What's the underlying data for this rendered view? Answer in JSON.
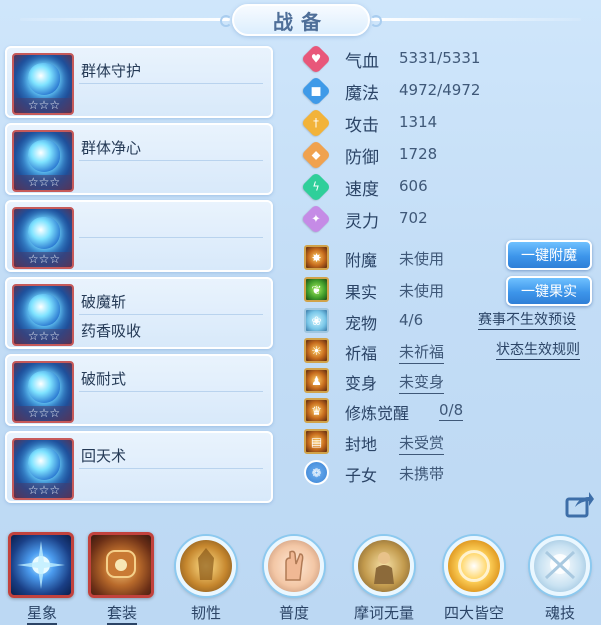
{
  "title": "战备",
  "skills": [
    {
      "name1": "群体守护",
      "name2": "",
      "stars": "☆☆☆"
    },
    {
      "name1": "群体净心",
      "name2": "",
      "stars": "☆☆☆"
    },
    {
      "name1": "",
      "name2": "",
      "stars": "☆☆☆"
    },
    {
      "name1": "破魔斩",
      "name2": "药香吸收",
      "stars": "☆☆☆"
    },
    {
      "name1": "破耐式",
      "name2": "",
      "stars": "☆☆☆"
    },
    {
      "name1": "回天术",
      "name2": "",
      "stars": "☆☆☆"
    }
  ],
  "stats": [
    {
      "label": "气血",
      "value": "5331/5331",
      "color": "#e8577a",
      "icon": "heart-icon",
      "glyph": "♥"
    },
    {
      "label": "魔法",
      "value": "4972/4972",
      "color": "#3f9ae8",
      "icon": "mana-icon",
      "glyph": "■"
    },
    {
      "label": "攻击",
      "value": "1314",
      "color": "#f2b33a",
      "icon": "sword-icon",
      "glyph": "†"
    },
    {
      "label": "防御",
      "value": "1728",
      "color": "#f0a24f",
      "icon": "shield-icon",
      "glyph": "◆"
    },
    {
      "label": "速度",
      "value": "606",
      "color": "#2fcf9a",
      "icon": "lightning-icon",
      "glyph": "ϟ"
    },
    {
      "label": "灵力",
      "value": "702",
      "color": "#c58be6",
      "icon": "spirit-icon",
      "glyph": "✦"
    }
  ],
  "equip": {
    "enchant": {
      "label": "附魔",
      "value": "未使用"
    },
    "fruit": {
      "label": "果实",
      "value": "未使用"
    },
    "pet": {
      "label": "宠物",
      "value": "4/6"
    },
    "blessing": {
      "label": "祈福",
      "value": "未祈福"
    },
    "transform": {
      "label": "变身",
      "value": "未变身"
    },
    "awaken": {
      "label": "修炼觉醒",
      "value": "0/8"
    },
    "fief": {
      "label": "封地",
      "value": "未受赏"
    },
    "children": {
      "label": "子女",
      "value": "未携带"
    }
  },
  "buttons": {
    "one_key_enchant": "一键附魔",
    "one_key_fruit": "一键果实",
    "event_preset": "赛事不生效预设",
    "status_rules": "状态生效规则"
  },
  "bottom_tabs": [
    {
      "label": "星象",
      "icon": "star-sign-icon"
    },
    {
      "label": "套装",
      "icon": "suit-icon"
    },
    {
      "label": "韧性",
      "icon": "tenacity-icon"
    },
    {
      "label": "普度",
      "icon": "salvation-icon"
    },
    {
      "label": "摩诃无量",
      "icon": "mahe-icon"
    },
    {
      "label": "四大皆空",
      "icon": "emptiness-icon"
    },
    {
      "label": "魂技",
      "icon": "soul-skill-icon"
    }
  ]
}
